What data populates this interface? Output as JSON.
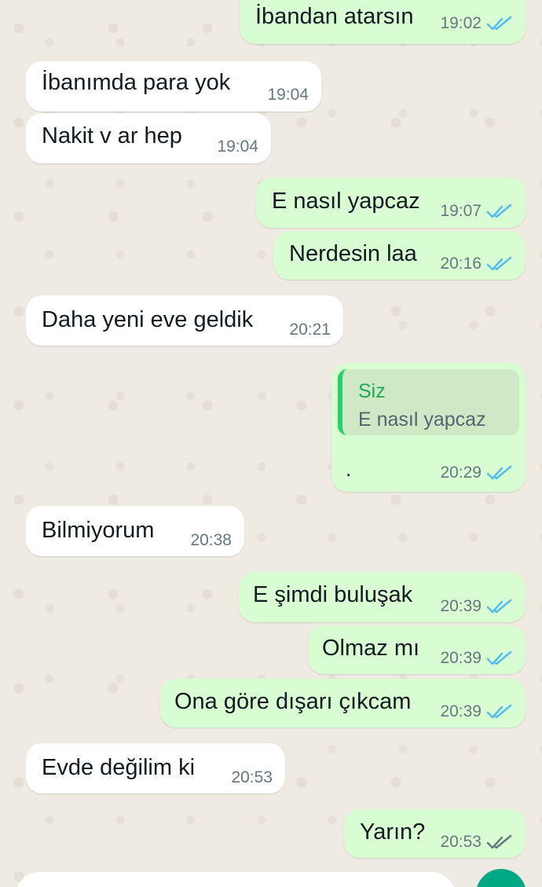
{
  "messages": [
    {
      "dir": "out",
      "text": "İbandan atarsın",
      "time": "19:02",
      "status": "read"
    },
    {
      "dir": "in",
      "text": "İbanımda para yok",
      "time": "19:04"
    },
    {
      "dir": "in",
      "text": "Nakit v ar hep",
      "time": "19:04"
    },
    {
      "dir": "out",
      "text": "E nasıl yapcaz",
      "time": "19:07",
      "status": "read"
    },
    {
      "dir": "out",
      "text": "Nerdesin laa",
      "time": "20:16",
      "status": "read"
    },
    {
      "dir": "in",
      "text": "Daha yeni eve geldik",
      "time": "20:21"
    },
    {
      "dir": "out",
      "quote_author": "Siz",
      "quote_text": "E nasıl yapcaz",
      "text": ".",
      "time": "20:29",
      "status": "read"
    },
    {
      "dir": "in",
      "text": "Bilmiyorum",
      "time": "20:38"
    },
    {
      "dir": "out",
      "text": "E şimdi buluşak",
      "time": "20:39",
      "status": "read"
    },
    {
      "dir": "out",
      "text": "Olmaz mı",
      "time": "20:39",
      "status": "read"
    },
    {
      "dir": "out",
      "text": "Ona göre dışarı çıkcam",
      "time": "20:39",
      "status": "read"
    },
    {
      "dir": "in",
      "text": "Evde değilim ki",
      "time": "20:53"
    },
    {
      "dir": "out",
      "text": "Yarın?",
      "time": "20:53",
      "status": "delivered"
    }
  ],
  "colors": {
    "wallpaper": "#efeae2",
    "incoming_bubble": "#ffffff",
    "outgoing_bubble": "#d9fdd3",
    "read_ticks": "#53bdeb",
    "delivered_ticks": "#667781",
    "accent": "#00a884"
  },
  "icons": {
    "read": "double-check-read-icon",
    "delivered": "double-check-delivered-icon"
  }
}
